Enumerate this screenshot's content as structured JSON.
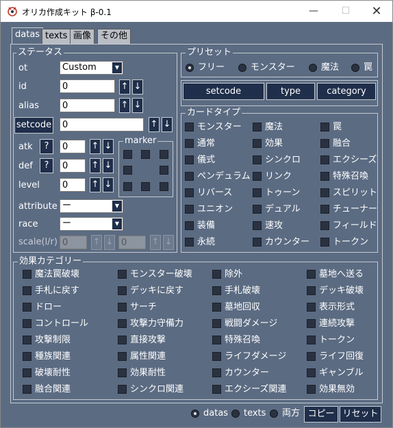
{
  "window": {
    "title": "オリカ作成キット β-0.1"
  },
  "tabs": [
    "datas",
    "texts",
    "画像",
    "その他"
  ],
  "status": {
    "title": "ステータス",
    "ot_label": "ot",
    "ot_value": "Custom",
    "id_label": "id",
    "id_value": "0",
    "alias_label": "alias",
    "alias_value": "0",
    "setcode_label": "setcode",
    "setcode_value": "0",
    "atk_label": "atk",
    "atk_value": "0",
    "def_label": "def",
    "def_value": "0",
    "level_label": "level",
    "level_value": "0",
    "help_label": "?",
    "up_label": "↑",
    "down_label": "↓",
    "marker_title": "marker",
    "attribute_label": "attribute",
    "attribute_value": "ー",
    "race_label": "race",
    "race_value": "ー",
    "scale_label": "scale(l/r)",
    "scale_left": "0",
    "scale_right": "0"
  },
  "preset": {
    "title": "プリセット",
    "options": [
      "フリー",
      "モンスター",
      "魔法",
      "罠"
    ],
    "selected": 0,
    "buttons": [
      "setcode",
      "type",
      "category"
    ]
  },
  "card_type": {
    "title": "カードタイプ",
    "items": [
      "モンスター",
      "魔法",
      "罠",
      "通常",
      "効果",
      "融合",
      "儀式",
      "シンクロ",
      "エクシーズ",
      "ペンデュラム",
      "リンク",
      "特殊召喚",
      "リバース",
      "トゥーン",
      "スピリット",
      "ユニオン",
      "デュアル",
      "チューナー",
      "装備",
      "速攻",
      "フィールド",
      "永続",
      "カウンター",
      "トークン"
    ]
  },
  "effect_category": {
    "title": "効果カテゴリー",
    "items": [
      "魔法罠破壊",
      "モンスター破壊",
      "除外",
      "墓地へ送る",
      "手札に戻す",
      "デッキに戻す",
      "手札破壊",
      "デッキ破壊",
      "ドロー",
      "サーチ",
      "墓地回収",
      "表示形式",
      "コントロール",
      "攻撃力守備力",
      "戦闘ダメージ",
      "連続攻撃",
      "攻撃制限",
      "直接攻撃",
      "特殊召喚",
      "トークン",
      "種族関連",
      "属性関連",
      "ライフダメージ",
      "ライフ回復",
      "破壊耐性",
      "効果耐性",
      "カウンター",
      "ギャンブル",
      "融合関連",
      "シンクロ関連",
      "エクシーズ関連",
      "効果無効"
    ]
  },
  "footer": {
    "options": [
      "datas",
      "texts",
      "両方"
    ],
    "selected": 0,
    "copy_label": "コピー",
    "reset_label": "リセット"
  }
}
